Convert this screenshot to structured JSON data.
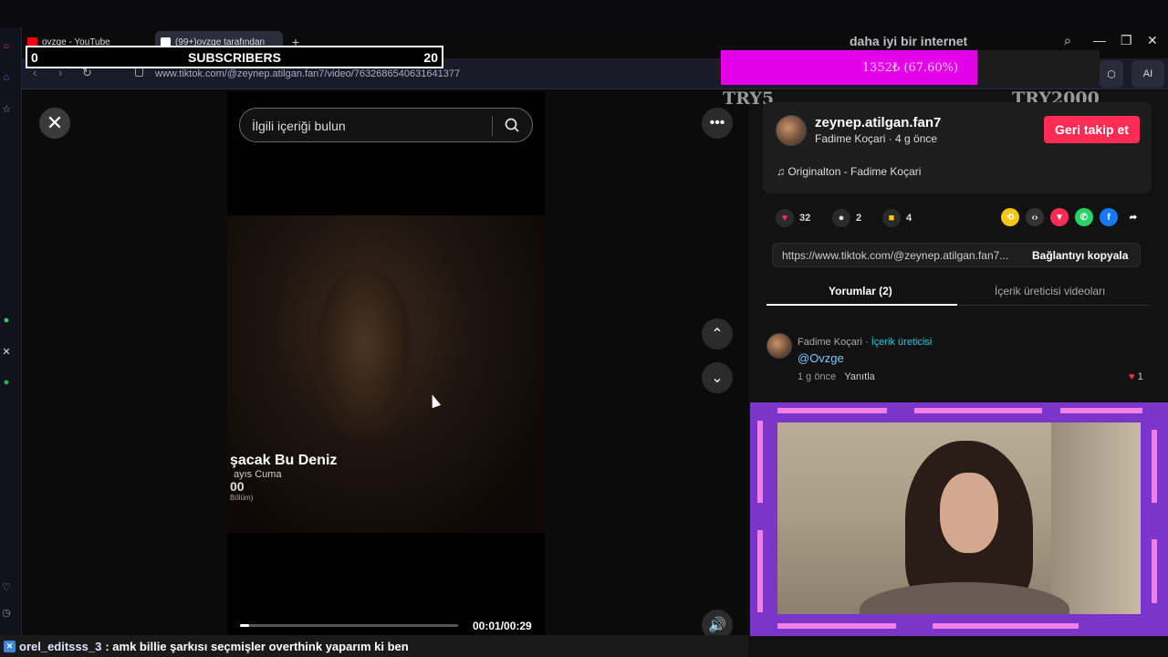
{
  "browser": {
    "tabs": [
      {
        "label": "ovzge - YouTube",
        "icon": "youtube-icon",
        "active": false
      },
      {
        "label": "(99+)ovzge tarafından",
        "icon": "tiktok-icon",
        "active": true
      }
    ],
    "url": "www.tiktok.com/@zeynep.atilgan.fan7/video/7632686540631641377",
    "promo_text": "daha iyi bir internet",
    "ai_button": "AI"
  },
  "overlay": {
    "subscribers": {
      "current": "0",
      "label": "SUBSCRIBERS",
      "goal": "20"
    },
    "goal_bar": {
      "text": "1352₺ (67.60%)",
      "percent": 67.6,
      "color": "#e400e8"
    },
    "try_left": "TRY5",
    "try_right": "TRY2000"
  },
  "video": {
    "search_placeholder": "İlgili içeriği bulun",
    "episode_title": "şacak Bu Deniz",
    "episode_sub": "ayıs Cuma",
    "episode_time": "00",
    "episode_note": "Bölüm)",
    "time": "00:01/00:29",
    "progress": 0.04
  },
  "post": {
    "username": "zeynep.atilgan.fan7",
    "meta": "Fadime Koçari · 4 g önce",
    "follow_label": "Geri takip et",
    "music": "Originalton - Fadime Koçari",
    "likes": "32",
    "comments": "2",
    "saves": "4",
    "link": "https://www.tiktok.com/@zeynep.atilgan.fan7...",
    "copy_label": "Bağlantıyı kopyala",
    "tabs": [
      "Yorumlar (2)",
      "İçerik üreticisi videoları"
    ]
  },
  "comment": {
    "author": "Fadime Koçari",
    "creator_badge": "İçerik üreticisi",
    "text": "@Ovzge",
    "age": "1 g önce",
    "reply": "Yanıtla",
    "likes": "1"
  },
  "chat": {
    "user": "orel_editsss_3",
    "message": ": amk billie şarkısı seçmişler overthink yaparım ki ben"
  },
  "colors": {
    "accent": "#fe2c55",
    "goal": "#e400e8",
    "frame": "#7b35c9",
    "mention": "#7ec8ff"
  }
}
